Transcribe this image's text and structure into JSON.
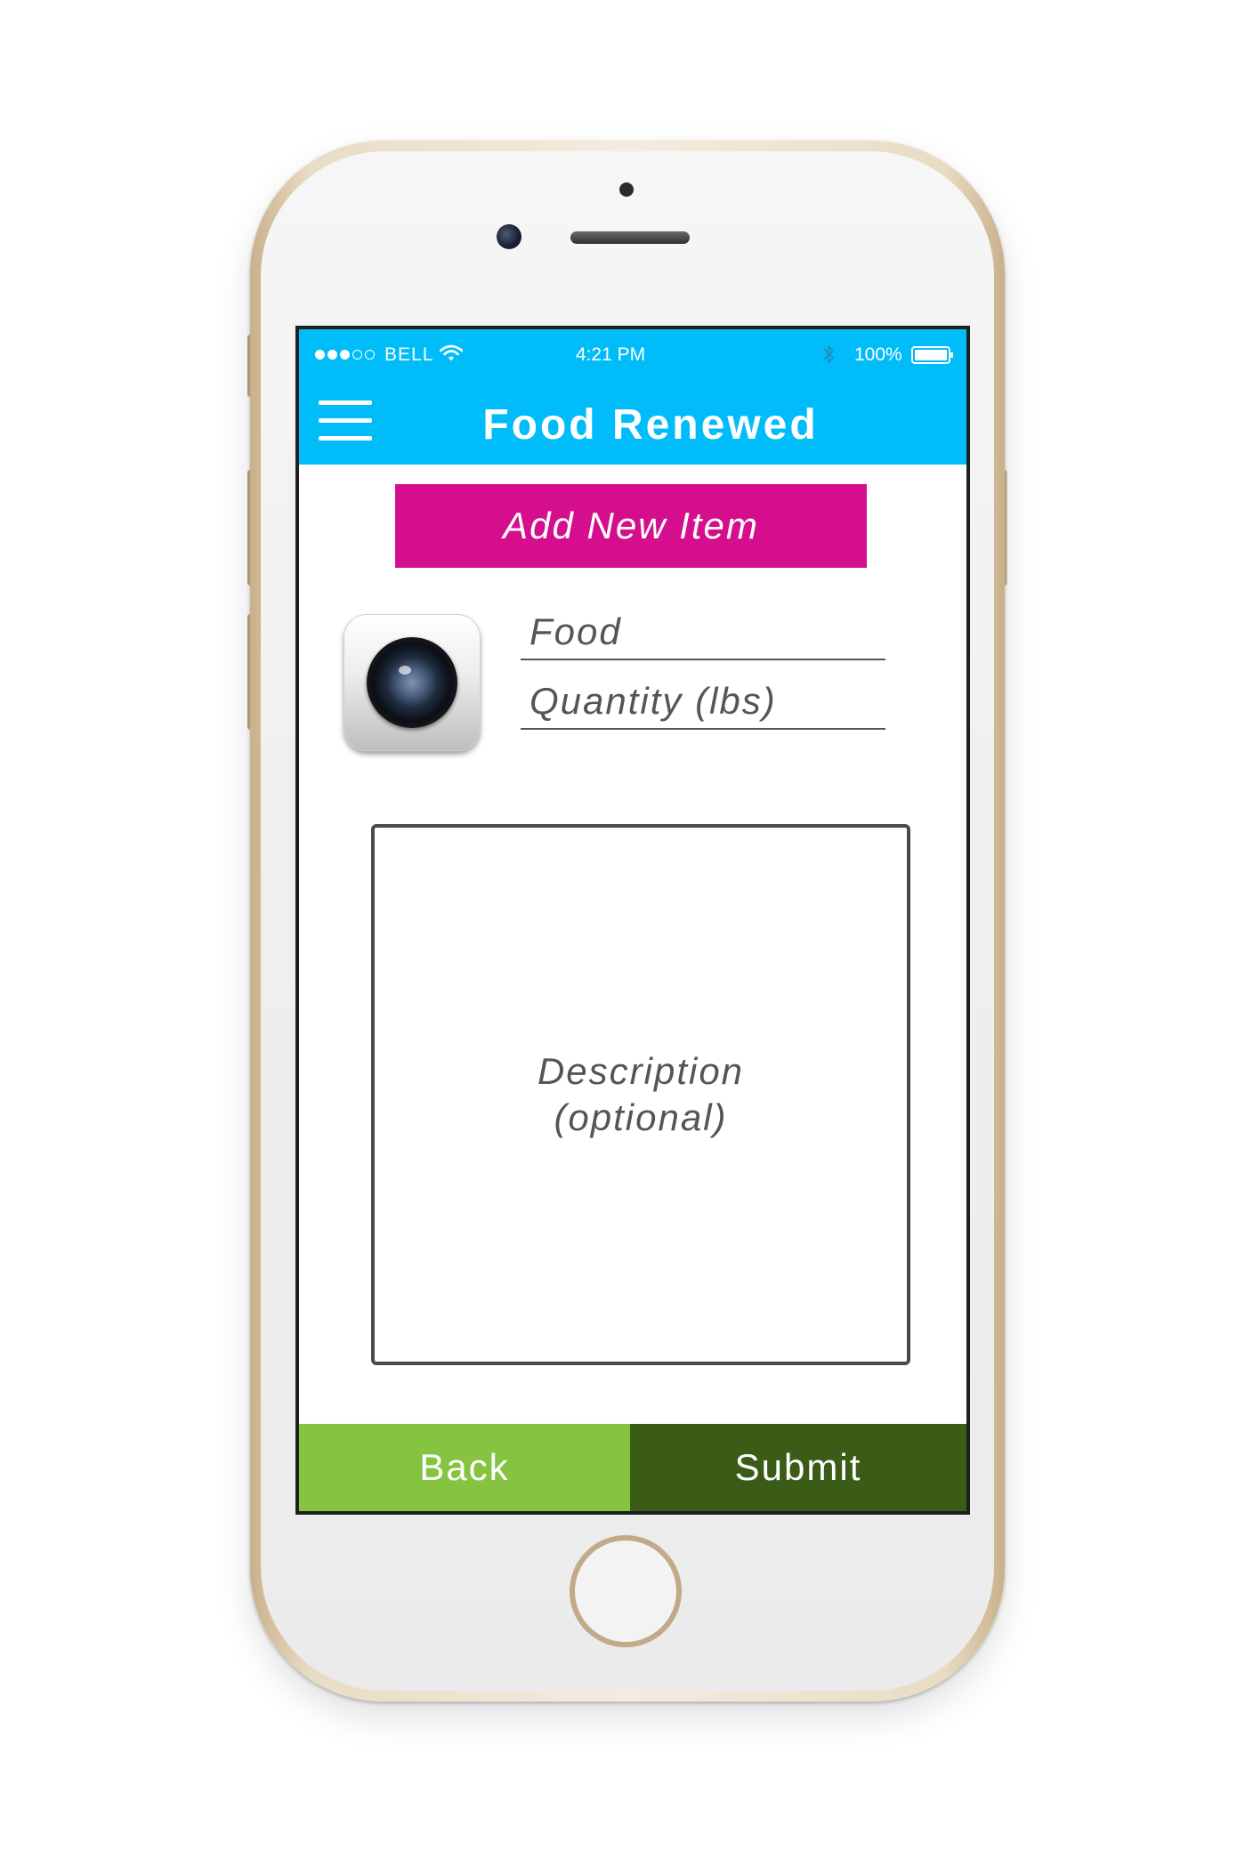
{
  "status_bar": {
    "carrier": "BELL",
    "time": "4:21 PM",
    "battery": "100%"
  },
  "app": {
    "title": "Food Renewed",
    "menu_icon": "hamburger-menu-icon",
    "header_color": "#00bcf8"
  },
  "form": {
    "banner_label": "Add New Item",
    "banner_color": "#d40e8c",
    "camera_icon": "camera-icon",
    "food_placeholder": "Food",
    "quantity_placeholder": "Quantity (lbs)",
    "description_placeholder": "Description\n(optional)"
  },
  "footer": {
    "back_label": "Back",
    "submit_label": "Submit",
    "back_color": "#86c340",
    "submit_color": "#3b5c16"
  }
}
